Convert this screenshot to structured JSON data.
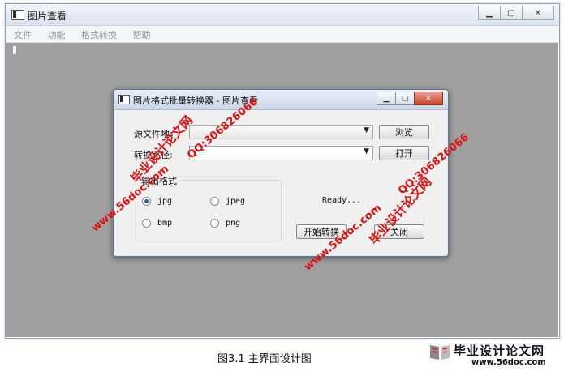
{
  "main_window": {
    "title": "图片查看",
    "menu": [
      "文件",
      "功能",
      "格式转换",
      "帮助"
    ]
  },
  "dialog": {
    "title": "图片格式批量转换器 - 图片查看",
    "source_label": "源文件地:",
    "target_label": "转换路径:",
    "browse_label": "浏览",
    "open_label": "打开",
    "group_title": "输出格式",
    "formats": [
      {
        "label": "jpg",
        "checked": true
      },
      {
        "label": "jpeg",
        "checked": false
      },
      {
        "label": "bmp",
        "checked": false
      },
      {
        "label": "png",
        "checked": false
      }
    ],
    "status": "Ready...",
    "start_label": "开始转换",
    "close_label": "关闭"
  },
  "watermarks": {
    "cn": "毕业设计论文网",
    "qq": "QQ:306826066",
    "url": "www.56doc.com"
  },
  "caption": "图3.1 主界面设计图",
  "brand": {
    "name": "毕业设计论文网",
    "site": "www.56doc.com"
  },
  "colors": {
    "watermark": "#e01010",
    "workspace": "#a0a0a0",
    "radio_selected": "#2c5d9b"
  }
}
